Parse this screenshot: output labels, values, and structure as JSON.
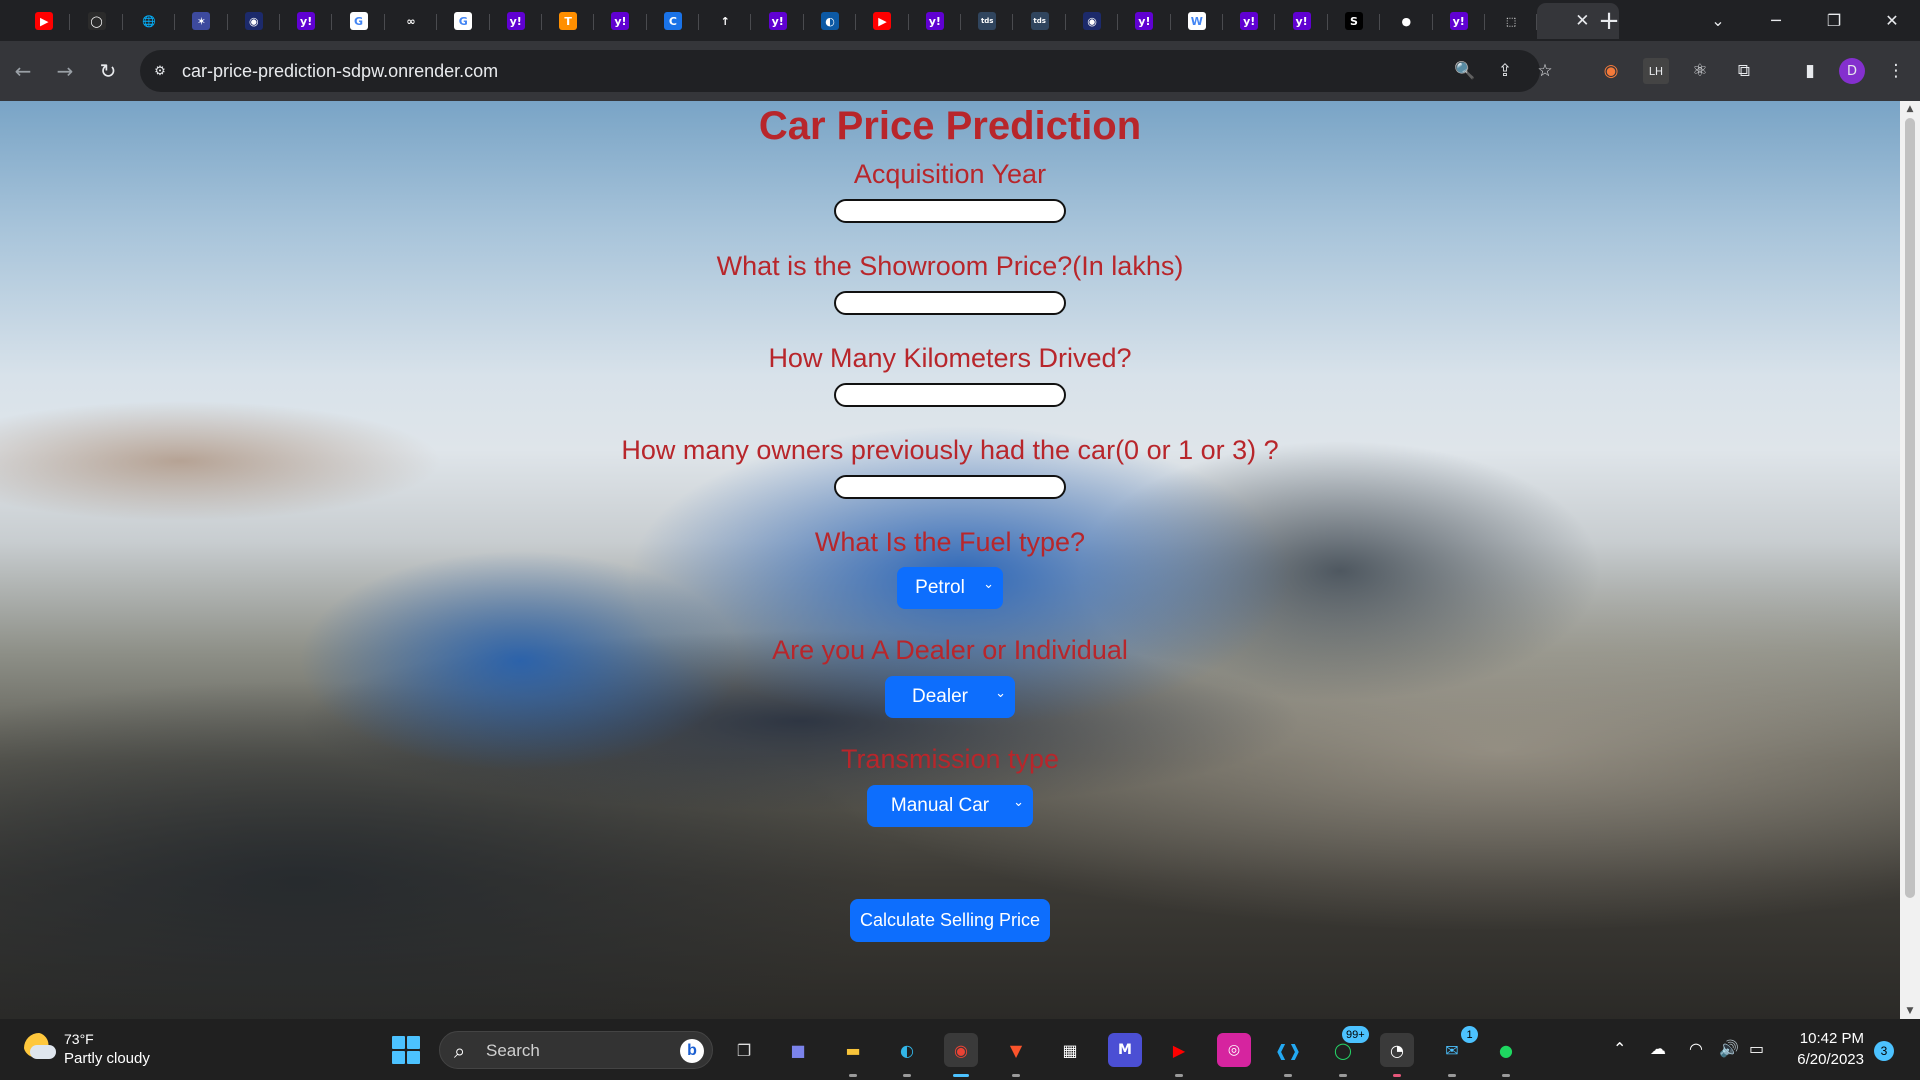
{
  "browser": {
    "tabs": [
      {
        "icon": "youtube-icon",
        "glyph": "▶",
        "bg": "#ff0000"
      },
      {
        "icon": "circle-app-icon",
        "glyph": "◯",
        "bg": "#2b2b2b"
      },
      {
        "icon": "globe-icon",
        "glyph": "🌐",
        "bg": "#202124"
      },
      {
        "icon": "pinwheel-icon",
        "glyph": "✶",
        "bg": "#3d4a9e"
      },
      {
        "icon": "seal-icon",
        "glyph": "◉",
        "bg": "#1c2a6b"
      },
      {
        "icon": "yahoo-icon",
        "glyph": "y!",
        "bg": "#6001d2"
      },
      {
        "icon": "google-icon",
        "glyph": "G",
        "bg": "#ffffff"
      },
      {
        "icon": "infinity-icon",
        "glyph": "∞",
        "bg": "#202124"
      },
      {
        "icon": "google-icon",
        "glyph": "G",
        "bg": "#ffffff"
      },
      {
        "icon": "yahoo-icon",
        "glyph": "y!",
        "bg": "#6001d2"
      },
      {
        "icon": "tensorflow-icon",
        "glyph": "T",
        "bg": "#ff8f00"
      },
      {
        "icon": "yahoo-icon",
        "glyph": "y!",
        "bg": "#6001d2"
      },
      {
        "icon": "c-icon",
        "glyph": "C",
        "bg": "#1a73e8"
      },
      {
        "icon": "arrow-up-icon",
        "glyph": "↑",
        "bg": "#202124"
      },
      {
        "icon": "yahoo-icon",
        "glyph": "y!",
        "bg": "#6001d2"
      },
      {
        "icon": "edge-icon",
        "glyph": "◐",
        "bg": "#0c59a4"
      },
      {
        "icon": "youtube-icon",
        "glyph": "▶",
        "bg": "#ff0000"
      },
      {
        "icon": "yahoo-icon",
        "glyph": "y!",
        "bg": "#6001d2"
      },
      {
        "icon": "tds-icon",
        "glyph": "tds",
        "bg": "#30455e"
      },
      {
        "icon": "tds-icon",
        "glyph": "tds",
        "bg": "#30455e"
      },
      {
        "icon": "seal-icon",
        "glyph": "◉",
        "bg": "#1c2a6b"
      },
      {
        "icon": "yahoo-icon",
        "glyph": "y!",
        "bg": "#6001d2"
      },
      {
        "icon": "wikipedia-icon",
        "glyph": "W",
        "bg": "#ffffff"
      },
      {
        "icon": "yahoo-icon",
        "glyph": "y!",
        "bg": "#6001d2"
      },
      {
        "icon": "yahoo-icon",
        "glyph": "y!",
        "bg": "#6001d2"
      },
      {
        "icon": "s-icon",
        "glyph": "S",
        "bg": "#000000"
      },
      {
        "icon": "github-icon",
        "glyph": "●",
        "bg": "#202124"
      },
      {
        "icon": "yahoo-icon",
        "glyph": "y!",
        "bg": "#6001d2"
      },
      {
        "icon": "render-icon",
        "glyph": "⬚",
        "bg": "#202124"
      }
    ],
    "active_tab_close": "✕",
    "new_tab": "+",
    "url": "car-price-prediction-sdpw.onrender.com",
    "profile_initial": "D"
  },
  "page": {
    "title": "Car Price Prediction",
    "fields": [
      {
        "label": "Acquisition Year",
        "value": ""
      },
      {
        "label": "What is the Showroom Price?(In lakhs)",
        "value": ""
      },
      {
        "label": "How Many Kilometers Drived?",
        "value": ""
      },
      {
        "label": "How many owners previously had the car(0 or 1 or 3) ?",
        "value": ""
      }
    ],
    "fuel": {
      "label": "What Is the Fuel type?",
      "selected": "Petrol"
    },
    "seller": {
      "label": "Are you A Dealer or Individual",
      "selected": "Dealer"
    },
    "transmission": {
      "label": "Transmission type",
      "selected": "Manual Car"
    },
    "submit_label": "Calculate Selling Price",
    "accent": "#0d6efd",
    "label_color": "#b8262b"
  },
  "taskbar": {
    "temperature": "73°F",
    "condition": "Partly cloudy",
    "search_placeholder": "Search",
    "whatsapp_badge": "99+",
    "mail_badge": "1",
    "time": "10:42 PM",
    "date": "6/20/2023",
    "notification_count": "3"
  }
}
